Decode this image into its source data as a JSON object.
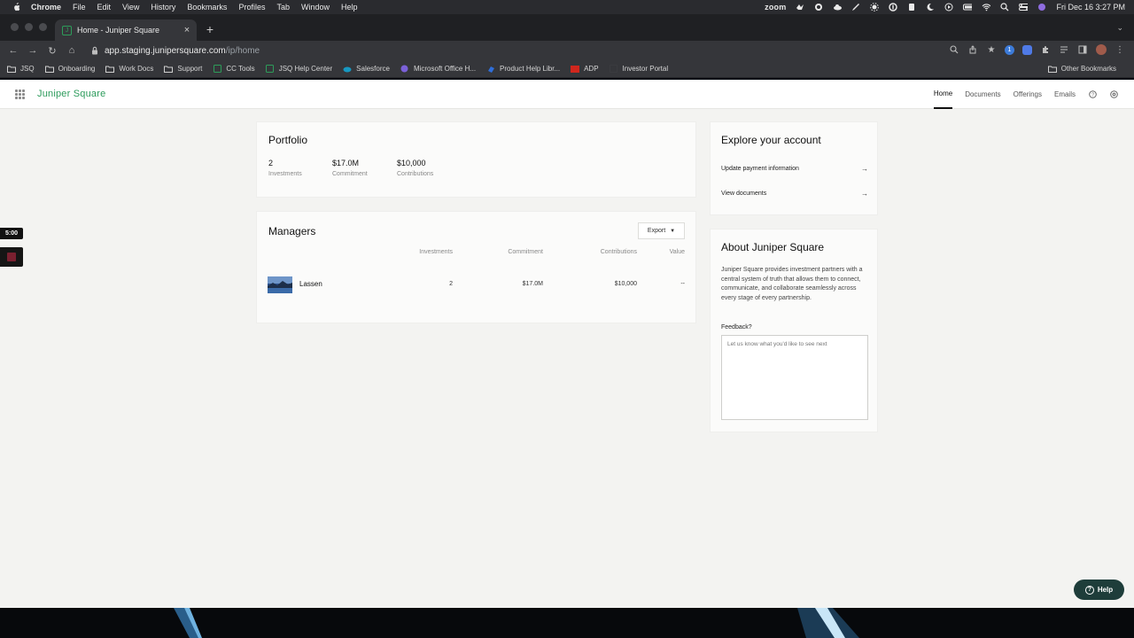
{
  "menubar": {
    "app": "Chrome",
    "items": [
      "File",
      "Edit",
      "View",
      "History",
      "Bookmarks",
      "Profiles",
      "Tab",
      "Window",
      "Help"
    ],
    "zoom_label": "zoom",
    "clock": "Fri Dec 16  3:27 PM"
  },
  "browser": {
    "tab_title": "Home - Juniper Square",
    "tab_favicon": "J",
    "url_host": "app.staging.junipersquare.com",
    "url_path": "/ip/home",
    "bookmarks": [
      "JSQ",
      "Onboarding",
      "Work Docs",
      "Support",
      "CC Tools",
      "JSQ Help Center",
      "Salesforce",
      "Microsoft Office H...",
      "Product Help Libr...",
      "ADP",
      "Investor Portal"
    ],
    "other_bookmarks": "Other Bookmarks"
  },
  "app": {
    "brand": "Juniper Square",
    "nav": [
      "Home",
      "Documents",
      "Offerings",
      "Emails"
    ],
    "brand_color": "#2c9b5b"
  },
  "portfolio": {
    "title": "Portfolio",
    "stats": [
      {
        "value": "2",
        "label": "Investments"
      },
      {
        "value": "$17.0M",
        "label": "Commitment"
      },
      {
        "value": "$10,000",
        "label": "Contributions"
      }
    ]
  },
  "managers": {
    "title": "Managers",
    "export_label": "Export",
    "columns": [
      "Investments",
      "Commitment",
      "Contributions",
      "Value"
    ],
    "rows": [
      {
        "name": "Lassen",
        "investments": "2",
        "commitment": "$17.0M",
        "contributions": "$10,000",
        "value": "--"
      }
    ]
  },
  "explore": {
    "title": "Explore your account",
    "links": [
      "Update payment information",
      "View documents"
    ]
  },
  "about": {
    "title": "About Juniper Square",
    "description": "Juniper Square provides investment partners with a central system of truth that allows them to connect, communicate, and collaborate seamlessly across every stage of every partnership.",
    "feedback_label": "Feedback?",
    "feedback_placeholder": "Let us know what you'd like to see next"
  },
  "recorder": {
    "timer": "5:00"
  },
  "help_button": "Help"
}
